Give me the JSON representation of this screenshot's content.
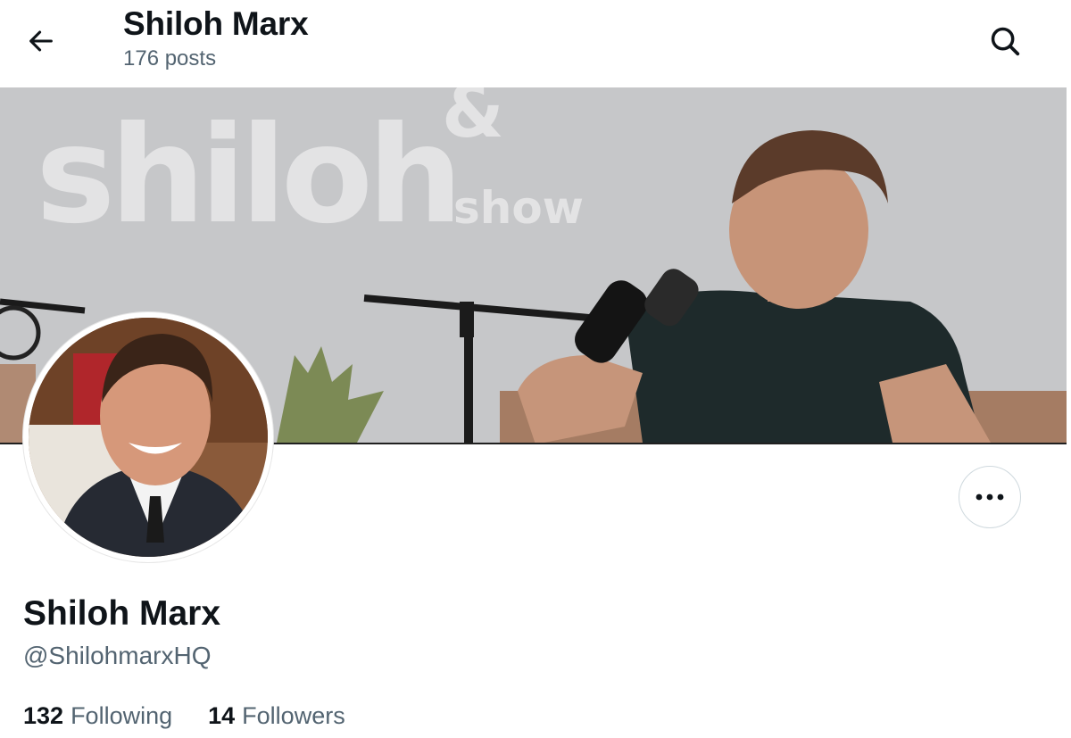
{
  "header": {
    "title": "Shiloh Marx",
    "post_count": "176 posts",
    "back_icon": "arrow-left-icon",
    "search_icon": "search-icon"
  },
  "banner": {
    "logo_word": "shiloh",
    "logo_amp": "&",
    "logo_show": "show"
  },
  "profile": {
    "name": "Shiloh Marx",
    "handle": "@ShilohmarxHQ",
    "more_icon": "more-horizontal-icon"
  },
  "stats": {
    "following_count": "132",
    "following_label": "Following",
    "followers_count": "14",
    "followers_label": "Followers"
  },
  "colors": {
    "text_primary": "#0f1419",
    "text_secondary": "#536471",
    "border": "#cfd9de"
  }
}
